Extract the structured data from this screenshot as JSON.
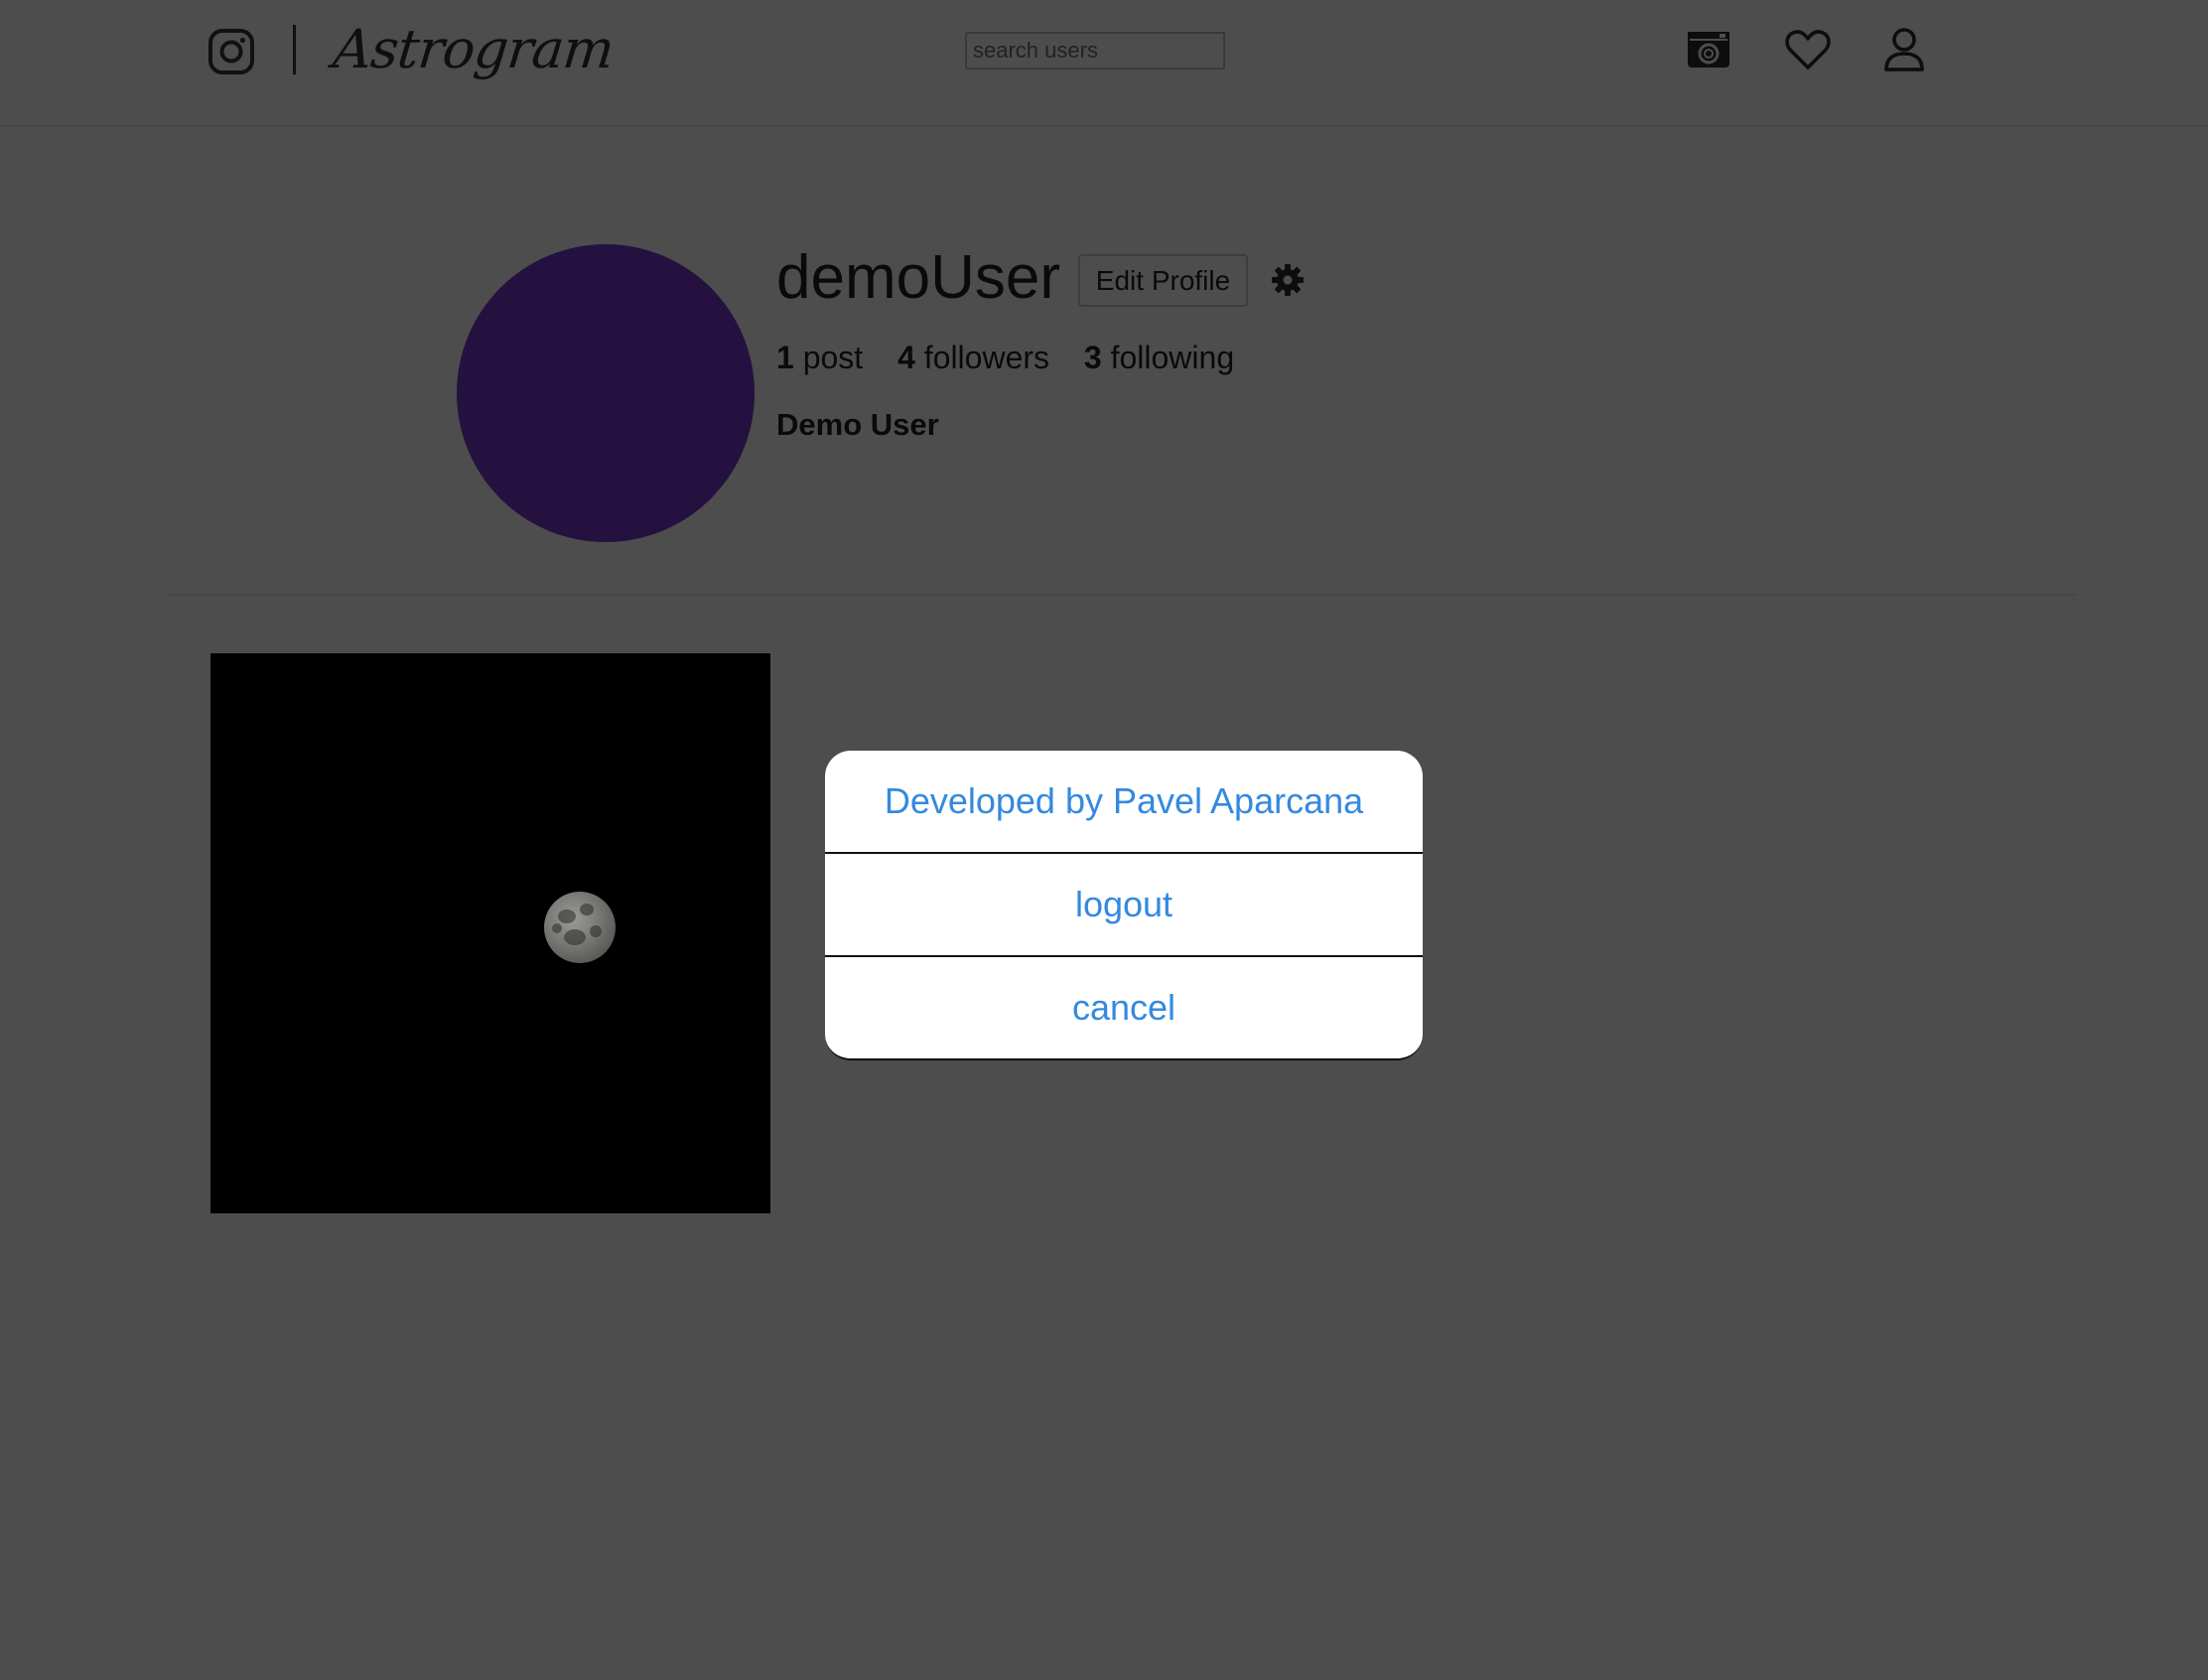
{
  "header": {
    "brand": "Astrogram",
    "search": {
      "placeholder": "search users",
      "value": ""
    },
    "nav_icons": [
      "camera-icon",
      "heart-icon",
      "user-icon"
    ]
  },
  "profile": {
    "username": "demoUser",
    "edit_label": "Edit Profile",
    "full_name": "Demo User",
    "stats": [
      {
        "count": "1",
        "label": "post"
      },
      {
        "count": "4",
        "label": "followers"
      },
      {
        "count": "3",
        "label": "following"
      }
    ],
    "avatar_color": "#25113f"
  },
  "posts": [
    {
      "image": "moon-photo"
    }
  ],
  "modal": {
    "items": [
      {
        "label": "Developed by Pavel Aparcana"
      },
      {
        "label": "logout"
      },
      {
        "label": "cancel"
      }
    ]
  },
  "colors": {
    "overlay_background": "#4d4d4d",
    "modal_text": "#3489e0",
    "avatar": "#25113f"
  }
}
